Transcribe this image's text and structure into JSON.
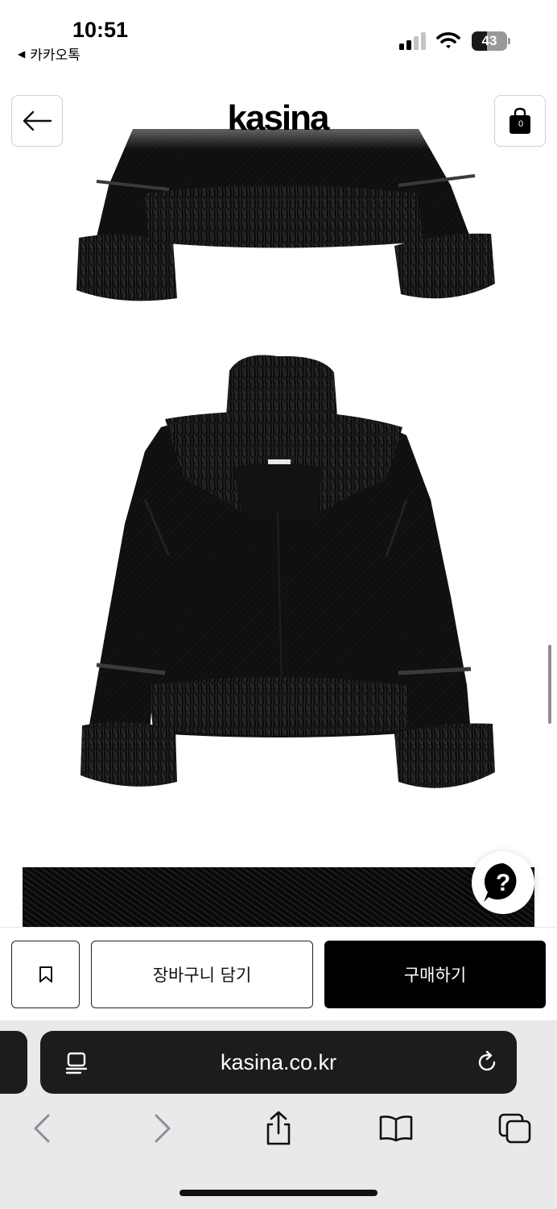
{
  "status_bar": {
    "time": "10:51",
    "back_app": "카카오톡",
    "battery_percent": 43,
    "battery_label": "43"
  },
  "header": {
    "logo": "kasina",
    "back_icon": "arrow-left-icon",
    "bag_icon": "shopping-bag-icon",
    "bag_count": "0"
  },
  "product_images": [
    {
      "description_icon": "jacket-front-bottom-image"
    },
    {
      "description_icon": "jacket-back-image"
    },
    {
      "description_icon": "fur-detail-image"
    }
  ],
  "help": {
    "icon": "question-chat-icon"
  },
  "actions": {
    "bookmark_icon": "bookmark-icon",
    "cart_label": "장바구니 담기",
    "buy_label": "구매하기"
  },
  "browser": {
    "url": "kasina.co.kr",
    "page_icon": "page-menu-icon",
    "reload_icon": "reload-icon",
    "toolbar": [
      "back-icon",
      "forward-icon",
      "share-icon",
      "bookmarks-icon",
      "tabs-icon"
    ]
  },
  "colors": {
    "accent": "#000000",
    "background": "#ffffff",
    "safari_bar": "#e9e9eb",
    "url_bar": "#1c1c1e"
  }
}
